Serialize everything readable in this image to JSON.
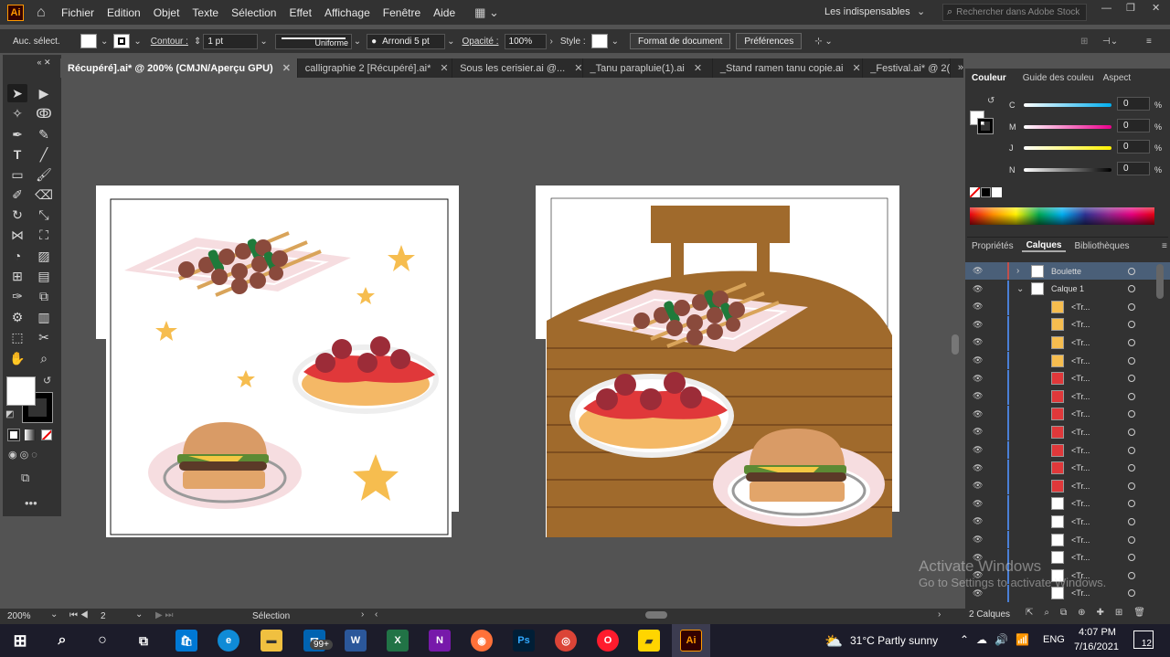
{
  "menubar": {
    "app_icon": "Ai",
    "items": [
      "Fichier",
      "Edition",
      "Objet",
      "Texte",
      "Sélection",
      "Effet",
      "Affichage",
      "Fenêtre",
      "Aide"
    ],
    "workspace": "Les indispensables",
    "search_placeholder": "Rechercher dans Adobe Stock"
  },
  "control": {
    "selection_label": "Auc. sélect.",
    "stroke_label": "Contour :",
    "stroke_value": "1 pt",
    "profile": "Uniforme",
    "brush": "Arrondi 5 pt",
    "opacity_label": "Opacité :",
    "opacity_value": "100%",
    "style_label": "Style :",
    "doc_format_button": "Format de document",
    "preferences_button": "Préférences"
  },
  "tabs": [
    {
      "label": "Récupéré].ai* @ 200% (CMJN/Aperçu GPU)",
      "active": true
    },
    {
      "label": "calligraphie 2 [Récupéré].ai*",
      "active": false
    },
    {
      "label": "Sous les cerisier.ai @...",
      "active": false
    },
    {
      "label": "_Tanu parapluie(1).ai",
      "active": false
    },
    {
      "label": "_Stand ramen tanu copie.ai",
      "active": false
    },
    {
      "label": "_Festival.ai* @ 2(",
      "active": false
    }
  ],
  "color_panel": {
    "tabs": [
      "Couleur",
      "Guide des couleu",
      "Aspect"
    ],
    "channels": [
      {
        "name": "C",
        "value": "0",
        "color": "#00aeef"
      },
      {
        "name": "M",
        "value": "0",
        "color": "#ec008c"
      },
      {
        "name": "J",
        "value": "0",
        "color": "#fff200"
      },
      {
        "name": "N",
        "value": "0",
        "color": "#000000"
      }
    ],
    "pct": "%"
  },
  "layers_panel": {
    "tabs": [
      "Propriétés",
      "Calques",
      "Bibliothèques"
    ],
    "layers": [
      {
        "name": "Boulette",
        "level": 0,
        "expanded": false,
        "selected": true
      },
      {
        "name": "Calque 1",
        "level": 0,
        "expanded": true,
        "selected": false
      },
      {
        "name": "<Tr...",
        "level": 1
      },
      {
        "name": "<Tr...",
        "level": 1
      },
      {
        "name": "<Tr...",
        "level": 1
      },
      {
        "name": "<Tr...",
        "level": 1
      },
      {
        "name": "<Tr...",
        "level": 1
      },
      {
        "name": "<Tr...",
        "level": 1
      },
      {
        "name": "<Tr...",
        "level": 1
      },
      {
        "name": "<Tr...",
        "level": 1
      },
      {
        "name": "<Tr...",
        "level": 1
      },
      {
        "name": "<Tr...",
        "level": 1
      },
      {
        "name": "<Tr...",
        "level": 1
      },
      {
        "name": "<Tr...",
        "level": 1
      },
      {
        "name": "<Tr...",
        "level": 1
      },
      {
        "name": "<Tr...",
        "level": 1
      },
      {
        "name": "<Tr...",
        "level": 1
      },
      {
        "name": "<Tr...",
        "level": 1
      },
      {
        "name": "<Tr...",
        "level": 1
      }
    ],
    "count": "2 Calques"
  },
  "status": {
    "zoom": "200%",
    "artboard": "2",
    "tool": "Sélection"
  },
  "watermark": {
    "line1": "Activate Windows",
    "line2": "Go to Settings to activate Windows."
  },
  "taskbar": {
    "weather": "31°C  Partly sunny",
    "lang": "ENG",
    "time": "4:07 PM",
    "date": "7/16/2021",
    "mail_badge": "99+",
    "notif_count": "12"
  }
}
